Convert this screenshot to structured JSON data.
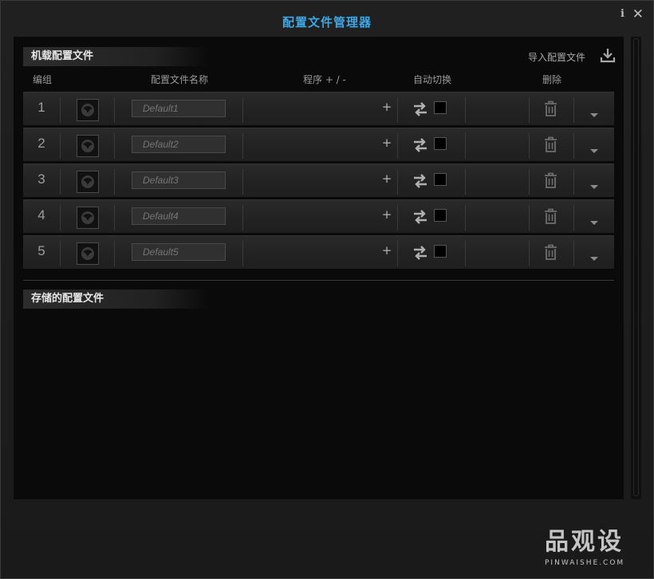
{
  "window": {
    "title": "配置文件管理器",
    "info_label": "i",
    "close_label": "✕"
  },
  "onboard": {
    "section_title": "机载配置文件",
    "import_label": "导入配置文件",
    "columns": {
      "group": "编组",
      "profile_name": "配置文件名称",
      "program": "程序 + / -",
      "auto_switch": "自动切换",
      "delete": "删除"
    },
    "rows": [
      {
        "number": "1",
        "name_placeholder": "Default1",
        "add_label": "+",
        "auto_switch": false
      },
      {
        "number": "2",
        "name_placeholder": "Default2",
        "add_label": "+",
        "auto_switch": false
      },
      {
        "number": "3",
        "name_placeholder": "Default3",
        "add_label": "+",
        "auto_switch": false
      },
      {
        "number": "4",
        "name_placeholder": "Default4",
        "add_label": "+",
        "auto_switch": false
      },
      {
        "number": "5",
        "name_placeholder": "Default5",
        "add_label": "+",
        "auto_switch": false
      }
    ]
  },
  "stored": {
    "section_title": "存储的配置文件"
  },
  "watermark": {
    "main": "品观设",
    "sub": "PINWAISHE.COM"
  },
  "icons": {
    "avatar": "roccat-logo-icon",
    "swap": "swap-arrows-icon",
    "delete": "trash-icon",
    "expand": "chevron-down-icon",
    "import": "download-icon"
  },
  "colors": {
    "accent": "#3ea7e6",
    "panel": "#0a0a0a",
    "row": "#262626"
  }
}
